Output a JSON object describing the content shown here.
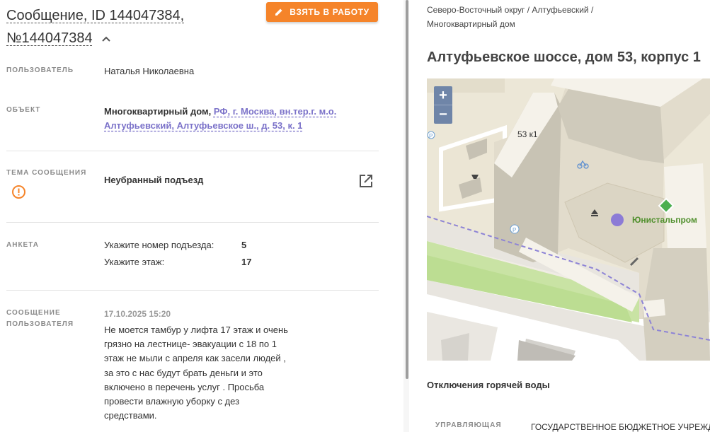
{
  "message": {
    "title_line1": "Сообщение, ID 144047384,",
    "title_line2": "№144047384",
    "take_button": "ВЗЯТЬ В РАБОТУ"
  },
  "fields": {
    "user_label": "ПОЛЬЗОВАТЕЛЬ",
    "user_value": "Наталья Николаевна",
    "object_label": "ОБЪЕКТ",
    "object_type": "Многоквартирный дом,",
    "object_address_1": "РФ, г. Москва, вн.тер.г. м.о.",
    "object_address_2": "Алтуфьевский, Алтуфьевское ш., д. 53, к. 1",
    "topic_label_1": "ТЕМА СООБЩЕНИЯ",
    "topic_value": "Неубранный подъезд",
    "survey_label": "АНКЕТА",
    "survey": [
      {
        "question": "Укажите номер подъезда:",
        "answer": "5"
      },
      {
        "question": "Укажите этаж:",
        "answer": "17"
      }
    ],
    "user_msg_label_1": "СООБЩЕНИЕ",
    "user_msg_label_2": "ПОЛЬЗОВАТЕЛЯ",
    "user_msg_date": "17.10.2025 15:20",
    "user_msg_text": "Не моется тамбур у лифта 17 этаж и очень\nгрязно на лестнице- эвакуации с 18 по 1\nэтаж не мыли с апреля как засели людей ,\nза это с нас будут брать деньги и это\nвключено в перечень услуг . Просьба\nпровести влажную уборку с дез\nсредствами."
  },
  "right": {
    "breadcrumb": "Северо-Восточный округ / Алтуфьевский /\nМногоквартирный дом",
    "address": "Алтуфьевское шоссе, дом 53, корпус 1",
    "map": {
      "zoom_in": "+",
      "zoom_out": "−",
      "building_label": "53 к1",
      "poi_label": "Юнистальпром",
      "parking": "P"
    },
    "hot_water_title": "Отключения горячей воды",
    "mgmt_label": "УПРАВЛЯЮЩАЯ",
    "mgmt_value": "ГОСУДАРСТВЕННОЕ БЮДЖЕТНОЕ УЧРЕЖДЕНИЕ"
  },
  "colors": {
    "accent_orange": "#f5842a",
    "link_purple": "#7b72c9",
    "poi_green": "#4caf50",
    "marker_purple": "#8c7bd6"
  },
  "icons": [
    "chevron-up-icon",
    "pencil-icon",
    "warning-icon",
    "external-link-icon",
    "parking-icon",
    "bicycle-icon",
    "poi-diamond-icon"
  ]
}
